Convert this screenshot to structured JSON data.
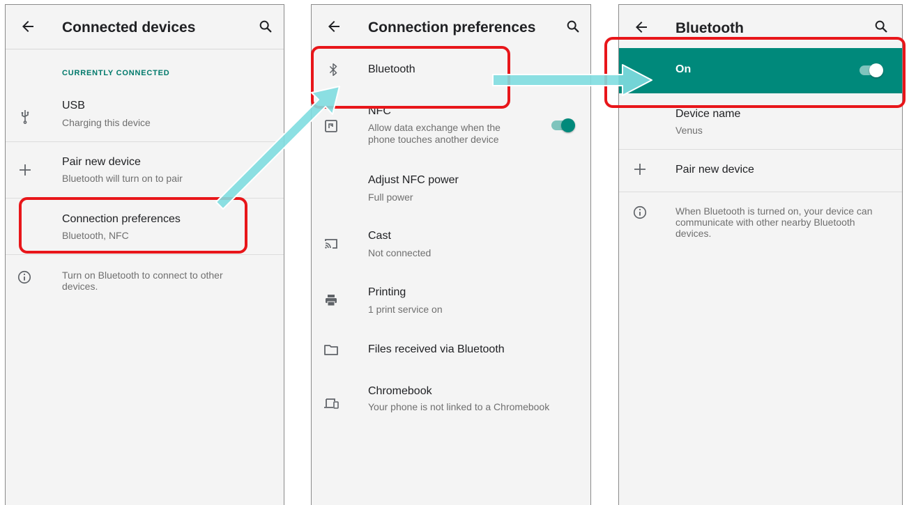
{
  "screens": [
    {
      "title": "Connected devices",
      "section_header": "CURRENTLY CONNECTED",
      "items": [
        {
          "icon": "usb-icon",
          "primary": "USB",
          "secondary": "Charging this device"
        },
        {
          "icon": "plus-icon",
          "primary": "Pair new device",
          "secondary": "Bluetooth will turn on to pair"
        },
        {
          "primary": "Connection preferences",
          "secondary": "Bluetooth, NFC"
        }
      ],
      "info": {
        "icon": "info-icon",
        "text": "Turn on Bluetooth to connect to other devices."
      }
    },
    {
      "title": "Connection preferences",
      "items": [
        {
          "icon": "bluetooth-icon",
          "primary": "Bluetooth"
        },
        {
          "icon": "nfc-icon",
          "primary": "NFC",
          "secondary": "Allow data exchange when the phone touches another device",
          "toggle": true
        },
        {
          "primary": "Adjust NFC power",
          "secondary": "Full power"
        },
        {
          "icon": "cast-icon",
          "primary": "Cast",
          "secondary": "Not connected"
        },
        {
          "icon": "printer-icon",
          "primary": "Printing",
          "secondary": "1 print service on"
        },
        {
          "icon": "folder-icon",
          "primary": "Files received via Bluetooth"
        },
        {
          "icon": "chromebook-icon",
          "primary": "Chromebook",
          "secondary": "Your phone is not linked to a Chromebook"
        }
      ]
    },
    {
      "title": "Bluetooth",
      "switch_label": "On",
      "switch_on": true,
      "items": [
        {
          "primary": "Device name",
          "secondary": "Venus"
        },
        {
          "icon": "plus-icon",
          "primary": "Pair new device"
        }
      ],
      "info": {
        "icon": "info-icon",
        "text": "When Bluetooth is turned on, your device can communicate with other nearby Bluetooth devices."
      }
    }
  ],
  "colors": {
    "accent": "#00897b",
    "section_header": "#00796b",
    "highlight": "#e8161a",
    "arrow": "#7fdde0",
    "background": "#f4f4f4"
  }
}
